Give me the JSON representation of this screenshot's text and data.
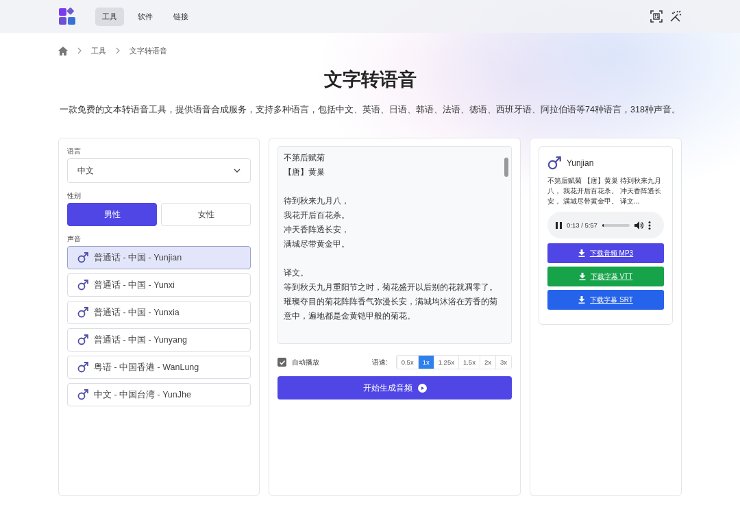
{
  "nav": {
    "tabs": [
      {
        "label": "工具",
        "selected": true
      },
      {
        "label": "软件",
        "selected": false
      },
      {
        "label": "链接",
        "selected": false
      }
    ]
  },
  "breadcrumb": [
    "工具",
    "文字转语音"
  ],
  "title": "文字转语音",
  "description": "一款免费的文本转语音工具，提供语音合成服务，支持多种语言，包括中文、英语、日语、韩语、法语、德语、西班牙语、阿拉伯语等74种语言，318种声音。",
  "settings": {
    "language_label": "语言",
    "language": "中文",
    "gender_label": "性别",
    "genders": [
      {
        "label": "男性",
        "selected": true
      },
      {
        "label": "女性",
        "selected": false
      }
    ],
    "voice_label": "声音",
    "voices": [
      {
        "label": "普通话 - 中国 - Yunjian",
        "selected": true
      },
      {
        "label": "普通话 - 中国 - Yunxi",
        "selected": false
      },
      {
        "label": "普通话 - 中国 - Yunxia",
        "selected": false
      },
      {
        "label": "普通话 - 中国 - Yunyang",
        "selected": false
      },
      {
        "label": "粤语 - 中国香港 - WanLung",
        "selected": false
      },
      {
        "label": "中文 - 中国台湾 - YunJhe",
        "selected": false
      }
    ]
  },
  "editor": {
    "paragraphs": [
      [
        "不第后赋菊",
        "【唐】黄巢"
      ],
      [
        "待到秋来九月八，",
        "我花开后百花杀。",
        "冲天香阵透长安，",
        "满城尽带黄金甲。"
      ],
      [
        "译文。",
        "等到秋天九月重阳节之时，菊花盛开以后别的花就凋零了。璀璨夺目的菊花阵阵香气弥漫长安，满城均沐浴在芳香的菊意中，遍地都是金黄铠甲般的菊花。"
      ]
    ],
    "autoplay": {
      "label": "自动播放",
      "checked": true
    },
    "speed_label": "语速:",
    "speeds": [
      {
        "label": "0.5x",
        "selected": false
      },
      {
        "label": "1x",
        "selected": true
      },
      {
        "label": "1.25x",
        "selected": false
      },
      {
        "label": "1.5x",
        "selected": false
      },
      {
        "label": "2x",
        "selected": false
      },
      {
        "label": "3x",
        "selected": false
      }
    ],
    "generate_button": "开始生成音频"
  },
  "result": {
    "voice": "Yunjian",
    "preview": "不第后赋菊 【唐】黄巢 待到秋来九月八， 我花开后百花杀。 冲天香阵透长安， 满城尽带黄金甲。 译文...",
    "player": {
      "time": "0:13 / 5:57",
      "level": 0.04
    },
    "downloads": [
      {
        "label": "下载音频 MP3",
        "color": "#4f46e5"
      },
      {
        "label": "下载字幕 VTT",
        "color": "#16a34a"
      },
      {
        "label": "下载字幕 SRT",
        "color": "#2563eb"
      }
    ]
  }
}
